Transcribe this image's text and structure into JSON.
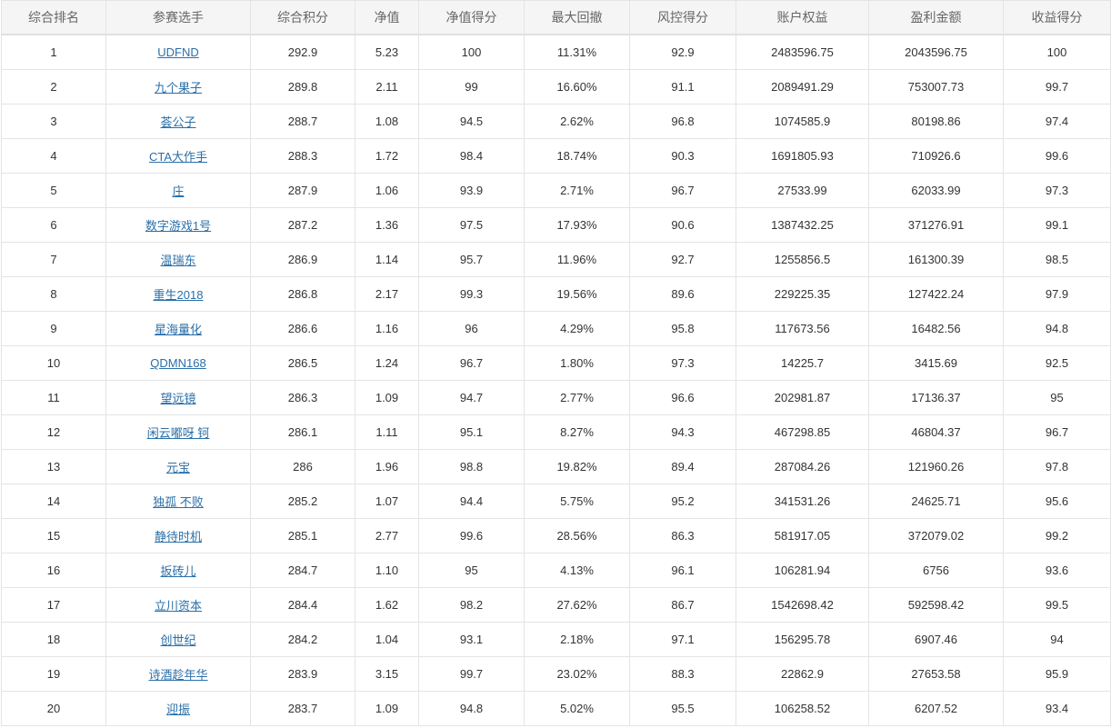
{
  "columns": [
    "综合排名",
    "参赛选手",
    "综合积分",
    "净值",
    "净值得分",
    "最大回撤",
    "风控得分",
    "账户权益",
    "盈利金额",
    "收益得分"
  ],
  "rows": [
    {
      "rank": "1",
      "player": "UDFND",
      "score": "292.9",
      "nav": "5.23",
      "nav_score": "100",
      "max_drawdown": "11.31%",
      "risk_score": "92.9",
      "equity": "2483596.75",
      "profit": "2043596.75",
      "return_score": "100"
    },
    {
      "rank": "2",
      "player": "九个果子",
      "score": "289.8",
      "nav": "2.11",
      "nav_score": "99",
      "max_drawdown": "16.60%",
      "risk_score": "91.1",
      "equity": "2089491.29",
      "profit": "753007.73",
      "return_score": "99.7"
    },
    {
      "rank": "3",
      "player": "荟公子",
      "score": "288.7",
      "nav": "1.08",
      "nav_score": "94.5",
      "max_drawdown": "2.62%",
      "risk_score": "96.8",
      "equity": "1074585.9",
      "profit": "80198.86",
      "return_score": "97.4"
    },
    {
      "rank": "4",
      "player": "CTA大作手",
      "score": "288.3",
      "nav": "1.72",
      "nav_score": "98.4",
      "max_drawdown": "18.74%",
      "risk_score": "90.3",
      "equity": "1691805.93",
      "profit": "710926.6",
      "return_score": "99.6"
    },
    {
      "rank": "5",
      "player": "庄",
      "score": "287.9",
      "nav": "1.06",
      "nav_score": "93.9",
      "max_drawdown": "2.71%",
      "risk_score": "96.7",
      "equity": "27533.99",
      "profit": "62033.99",
      "return_score": "97.3"
    },
    {
      "rank": "6",
      "player": "数字游戏1号",
      "score": "287.2",
      "nav": "1.36",
      "nav_score": "97.5",
      "max_drawdown": "17.93%",
      "risk_score": "90.6",
      "equity": "1387432.25",
      "profit": "371276.91",
      "return_score": "99.1"
    },
    {
      "rank": "7",
      "player": "温瑞东",
      "score": "286.9",
      "nav": "1.14",
      "nav_score": "95.7",
      "max_drawdown": "11.96%",
      "risk_score": "92.7",
      "equity": "1255856.5",
      "profit": "161300.39",
      "return_score": "98.5"
    },
    {
      "rank": "8",
      "player": "重生2018",
      "score": "286.8",
      "nav": "2.17",
      "nav_score": "99.3",
      "max_drawdown": "19.56%",
      "risk_score": "89.6",
      "equity": "229225.35",
      "profit": "127422.24",
      "return_score": "97.9"
    },
    {
      "rank": "9",
      "player": "星海量化",
      "score": "286.6",
      "nav": "1.16",
      "nav_score": "96",
      "max_drawdown": "4.29%",
      "risk_score": "95.8",
      "equity": "117673.56",
      "profit": "16482.56",
      "return_score": "94.8"
    },
    {
      "rank": "10",
      "player": "QDMN168",
      "score": "286.5",
      "nav": "1.24",
      "nav_score": "96.7",
      "max_drawdown": "1.80%",
      "risk_score": "97.3",
      "equity": "14225.7",
      "profit": "3415.69",
      "return_score": "92.5"
    },
    {
      "rank": "11",
      "player": "望远镜",
      "score": "286.3",
      "nav": "1.09",
      "nav_score": "94.7",
      "max_drawdown": "2.77%",
      "risk_score": "96.6",
      "equity": "202981.87",
      "profit": "17136.37",
      "return_score": "95"
    },
    {
      "rank": "12",
      "player": "闲云嘟呀 钶",
      "score": "286.1",
      "nav": "1.11",
      "nav_score": "95.1",
      "max_drawdown": "8.27%",
      "risk_score": "94.3",
      "equity": "467298.85",
      "profit": "46804.37",
      "return_score": "96.7"
    },
    {
      "rank": "13",
      "player": "元宝",
      "score": "286",
      "nav": "1.96",
      "nav_score": "98.8",
      "max_drawdown": "19.82%",
      "risk_score": "89.4",
      "equity": "287084.26",
      "profit": "121960.26",
      "return_score": "97.8"
    },
    {
      "rank": "14",
      "player": "独孤 不败",
      "score": "285.2",
      "nav": "1.07",
      "nav_score": "94.4",
      "max_drawdown": "5.75%",
      "risk_score": "95.2",
      "equity": "341531.26",
      "profit": "24625.71",
      "return_score": "95.6"
    },
    {
      "rank": "15",
      "player": "静待时机",
      "score": "285.1",
      "nav": "2.77",
      "nav_score": "99.6",
      "max_drawdown": "28.56%",
      "risk_score": "86.3",
      "equity": "581917.05",
      "profit": "372079.02",
      "return_score": "99.2"
    },
    {
      "rank": "16",
      "player": "扳砖儿",
      "score": "284.7",
      "nav": "1.10",
      "nav_score": "95",
      "max_drawdown": "4.13%",
      "risk_score": "96.1",
      "equity": "106281.94",
      "profit": "6756",
      "return_score": "93.6"
    },
    {
      "rank": "17",
      "player": "立川资本",
      "score": "284.4",
      "nav": "1.62",
      "nav_score": "98.2",
      "max_drawdown": "27.62%",
      "risk_score": "86.7",
      "equity": "1542698.42",
      "profit": "592598.42",
      "return_score": "99.5"
    },
    {
      "rank": "18",
      "player": "创世纪",
      "score": "284.2",
      "nav": "1.04",
      "nav_score": "93.1",
      "max_drawdown": "2.18%",
      "risk_score": "97.1",
      "equity": "156295.78",
      "profit": "6907.46",
      "return_score": "94"
    },
    {
      "rank": "19",
      "player": "诗酒趁年华",
      "score": "283.9",
      "nav": "3.15",
      "nav_score": "99.7",
      "max_drawdown": "23.02%",
      "risk_score": "88.3",
      "equity": "22862.9",
      "profit": "27653.58",
      "return_score": "95.9"
    },
    {
      "rank": "20",
      "player": "迎振",
      "score": "283.7",
      "nav": "1.09",
      "nav_score": "94.8",
      "max_drawdown": "5.02%",
      "risk_score": "95.5",
      "equity": "106258.52",
      "profit": "6207.52",
      "return_score": "93.4"
    }
  ]
}
